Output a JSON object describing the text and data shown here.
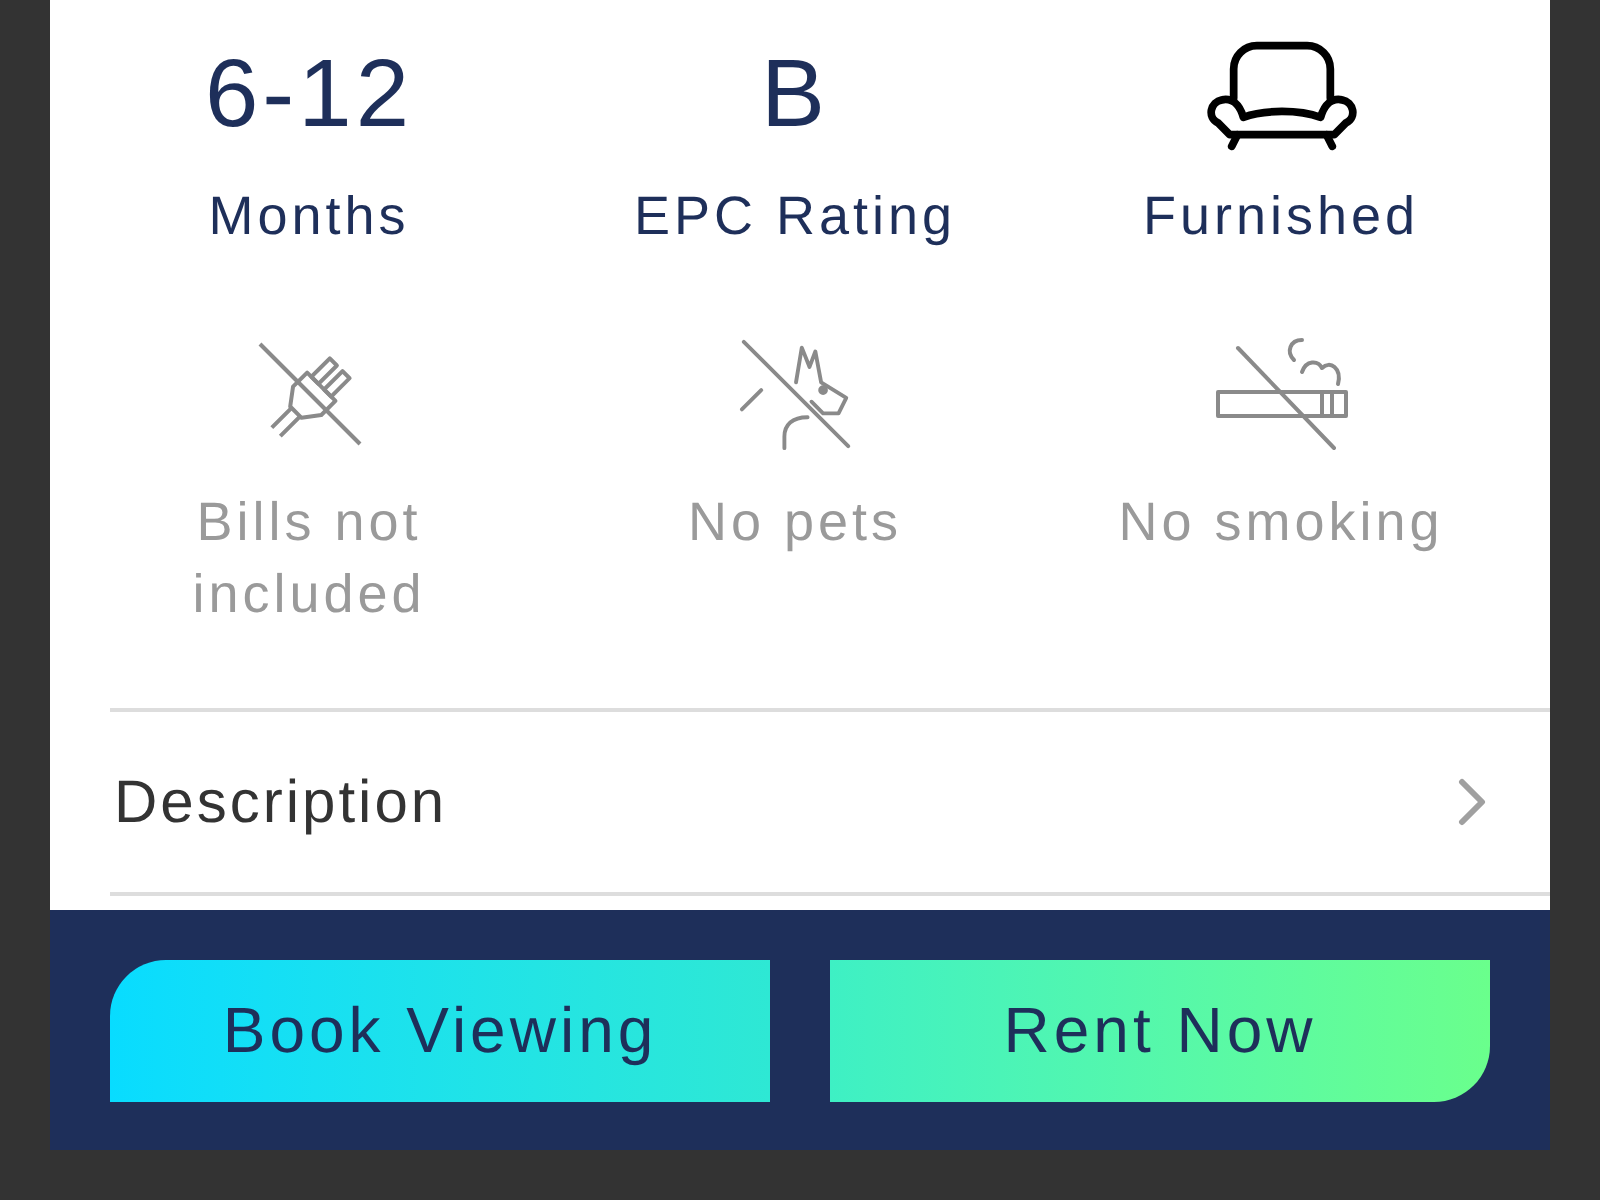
{
  "stats": [
    {
      "kind": "value",
      "value": "6-12",
      "label": "Months"
    },
    {
      "kind": "value",
      "value": "B",
      "label": "EPC Rating"
    },
    {
      "kind": "icon",
      "label": "Furnished"
    }
  ],
  "rules": [
    {
      "label": "Bills not included"
    },
    {
      "label": "No pets"
    },
    {
      "label": "No smoking"
    }
  ],
  "sections": [
    {
      "label": "Description"
    }
  ],
  "actions": [
    {
      "label": "Book Viewing"
    },
    {
      "label": "Rent Now"
    }
  ]
}
